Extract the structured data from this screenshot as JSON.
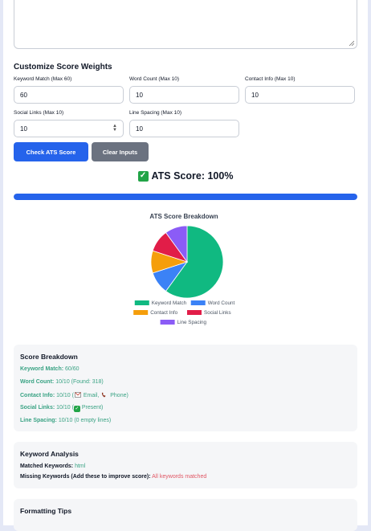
{
  "weights": {
    "title": "Customize Score Weights",
    "fields": [
      {
        "label": "Keyword Match (Max 60)",
        "value": "60"
      },
      {
        "label": "Word Count (Max 10)",
        "value": "10"
      },
      {
        "label": "Contact Info (Max 10)",
        "value": "10"
      },
      {
        "label": "Social Links (Max 10)",
        "value": "10"
      },
      {
        "label": "Line Spacing (Max 10)",
        "value": "10"
      }
    ]
  },
  "buttons": {
    "check": "Check ATS Score",
    "clear": "Clear Inputs"
  },
  "score": {
    "text": "ATS Score: 100%",
    "progress": 1.0,
    "color": "#2563eb"
  },
  "chart_data": {
    "type": "pie",
    "title": "ATS Score Breakdown",
    "categories": [
      "Keyword Match",
      "Word Count",
      "Contact Info",
      "Social Links",
      "Line Spacing"
    ],
    "values": [
      60,
      10,
      10,
      10,
      10
    ],
    "colors": [
      "#10b981",
      "#3b82f6",
      "#f59e0b",
      "#e11d48",
      "#8b5cf6"
    ],
    "legend": "bottom"
  },
  "breakdown": {
    "title": "Score Breakdown",
    "keyword": {
      "label": "Keyword Match:",
      "value": "60/60"
    },
    "word": {
      "label": "Word Count:",
      "value": "10/10 (Found: 318)"
    },
    "contact": {
      "label": "Contact Info:",
      "prefix": "10/10 (",
      "email": "Email,",
      "phone": "Phone)"
    },
    "social": {
      "label": "Social Links:",
      "prefix": "10/10 (",
      "suffix": "Present)"
    },
    "spacing": {
      "label": "Line Spacing:",
      "value": "10/10 (0 empty lines)"
    }
  },
  "keywords": {
    "title": "Keyword Analysis",
    "matched_label": "Matched Keywords:",
    "matched_value": "html",
    "missing_label": "Missing Keywords (Add these to improve score):",
    "missing_value": "All keywords matched"
  },
  "tips": {
    "title": "Formatting Tips"
  }
}
